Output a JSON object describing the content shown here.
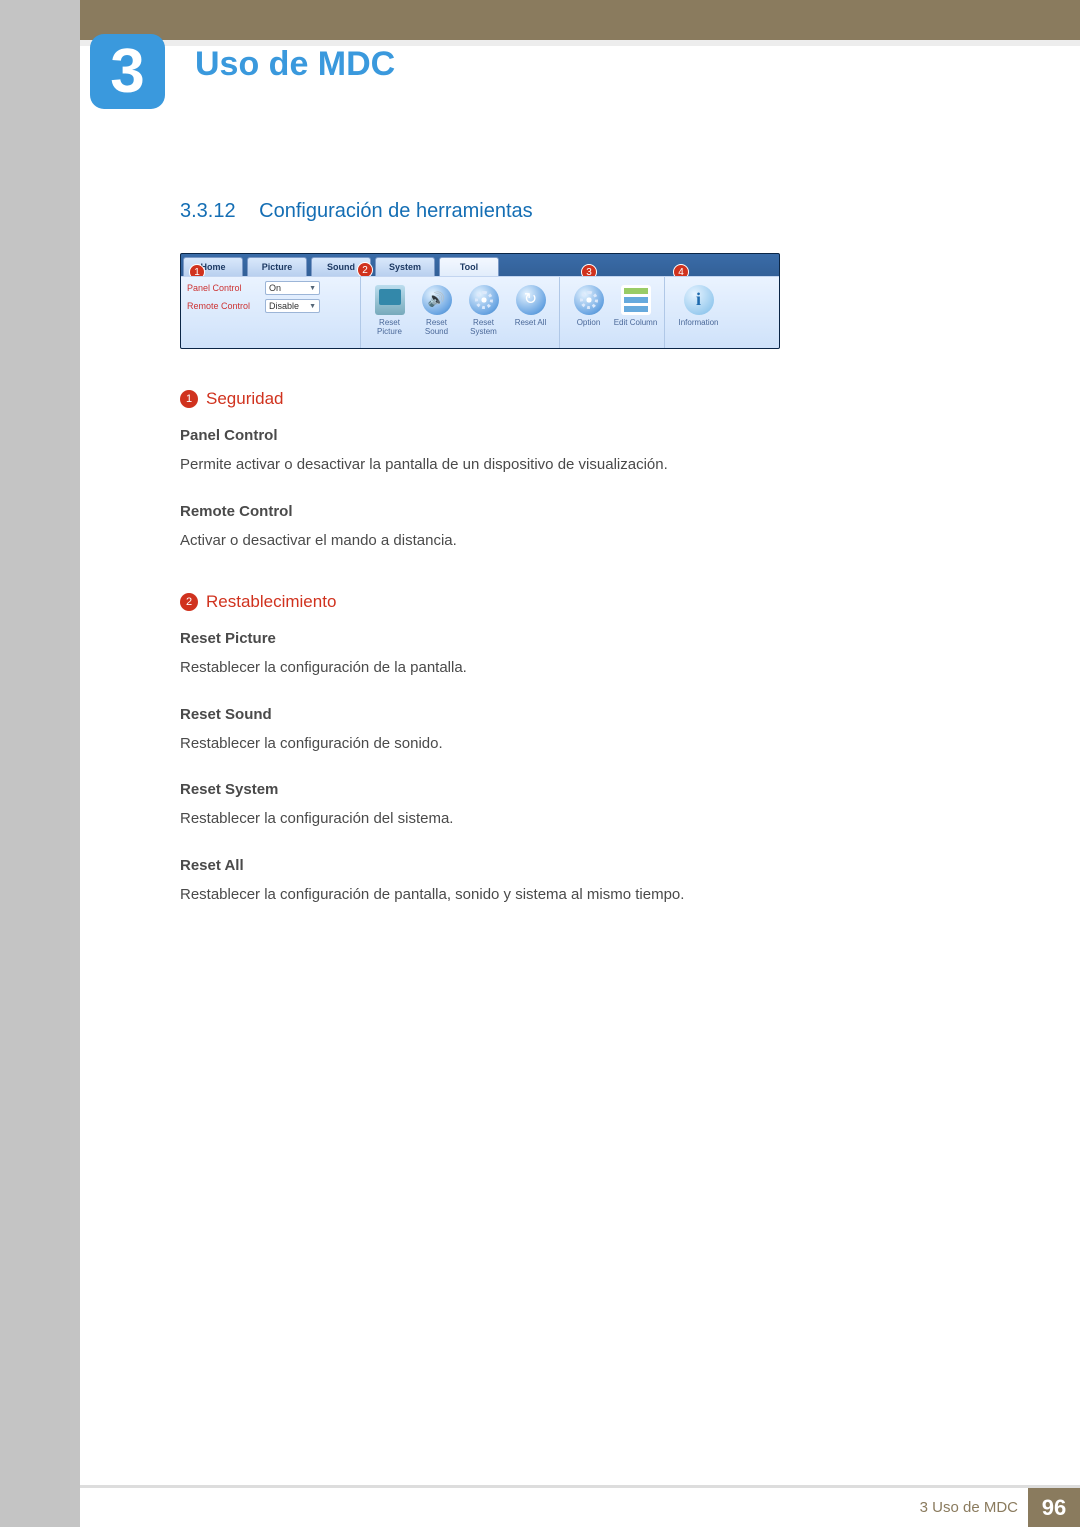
{
  "chapter": {
    "number": "3",
    "title": "Uso de MDC"
  },
  "section": {
    "number": "3.3.12",
    "title": "Configuración de herramientas"
  },
  "toolbar": {
    "tabs": [
      {
        "label": "Home"
      },
      {
        "label": "Picture"
      },
      {
        "label": "Sound"
      },
      {
        "label": "System"
      },
      {
        "label": "Tool"
      }
    ],
    "panel": {
      "control_label": "Panel Control",
      "control_value": "On",
      "remote_label": "Remote Control",
      "remote_value": "Disable"
    },
    "buttons": {
      "reset_picture": "Reset Picture",
      "reset_sound": "Reset Sound",
      "reset_system": "Reset System",
      "reset_all": "Reset All",
      "option": "Option",
      "edit_column": "Edit Column",
      "information": "Information"
    },
    "callouts": {
      "c1": "1",
      "c2": "2",
      "c3": "3",
      "c4": "4"
    }
  },
  "sec1": {
    "num": "1",
    "title": "Seguridad",
    "panel_control_h": "Panel Control",
    "panel_control_d": "Permite activar o desactivar la pantalla de un dispositivo de visualización.",
    "remote_control_h": "Remote Control",
    "remote_control_d": "Activar o desactivar el mando a distancia."
  },
  "sec2": {
    "num": "2",
    "title": "Restablecimiento",
    "reset_picture_h": "Reset Picture",
    "reset_picture_d": "Restablecer la configuración de la pantalla.",
    "reset_sound_h": "Reset Sound",
    "reset_sound_d": "Restablecer la configuración de sonido.",
    "reset_system_h": "Reset System",
    "reset_system_d": "Restablecer la configuración del sistema.",
    "reset_all_h": "Reset All",
    "reset_all_d": "Restablecer la configuración de pantalla, sonido y sistema al mismo tiempo."
  },
  "footer": {
    "text": "3 Uso de MDC",
    "page": "96"
  }
}
